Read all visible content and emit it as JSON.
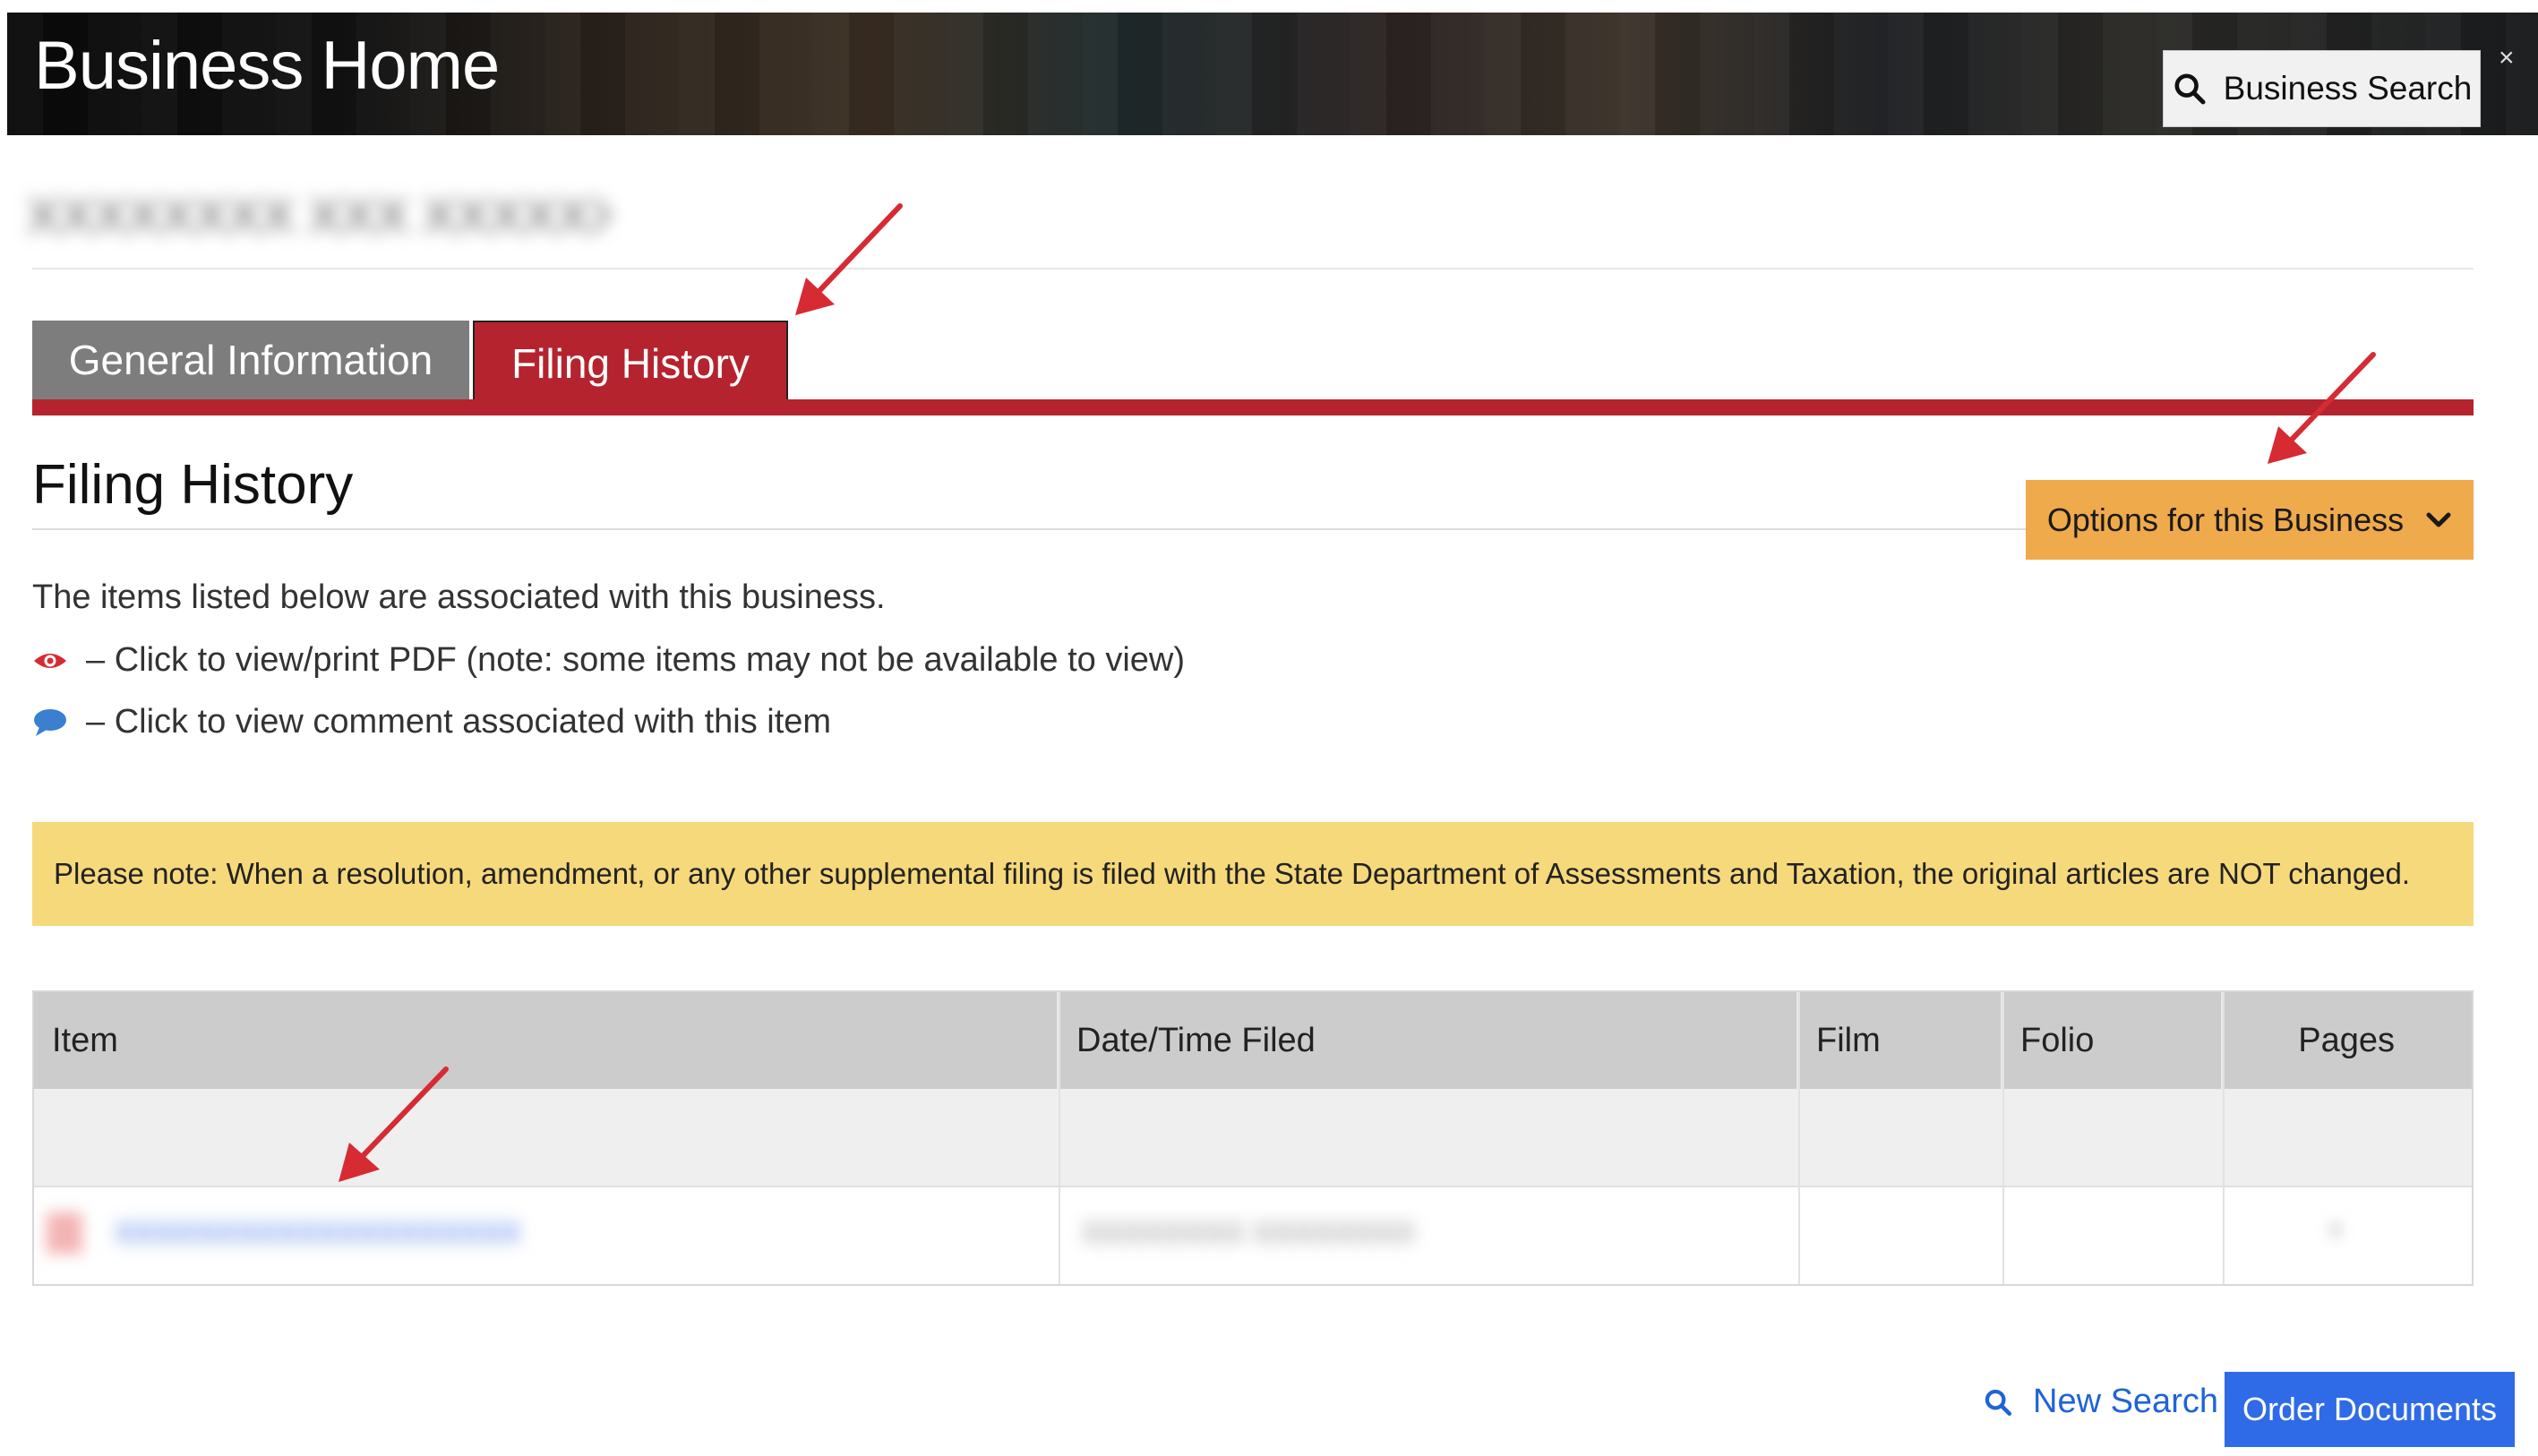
{
  "header": {
    "title": "Business Home",
    "search_button_label": "Business Search",
    "close_label": "×"
  },
  "business": {
    "name_blurred": "XXXXXXXX XXX XXXXXXXX"
  },
  "tabs": [
    {
      "label": "General Information",
      "active": false
    },
    {
      "label": "Filing History",
      "active": true
    }
  ],
  "section": {
    "title": "Filing History",
    "options_button_label": "Options for this Business",
    "intro": "The items listed below are associated with this business.",
    "legend": [
      {
        "icon": "eye-icon",
        "text": "– Click to view/print PDF (note: some items may not be available to view)"
      },
      {
        "icon": "comment-icon",
        "text": "– Click to view comment associated with this item"
      }
    ],
    "note": "Please note: When a resolution, amendment, or any other supplemental filing is filed with the State Department of Assessments and Taxation, the original articles are NOT changed."
  },
  "table": {
    "columns": [
      "Item",
      "Date/Time Filed",
      "Film",
      "Folio",
      "Pages"
    ],
    "rows": [
      {
        "item": "XXXXXXXXXXXXXXXXXXXX",
        "date": "XXXXXXXX XXXXXXXX",
        "pages": "X"
      }
    ]
  },
  "actions": {
    "new_search_label": "New Search",
    "order_documents_label": "Order Documents"
  },
  "colors": {
    "accent_red": "#b5232e",
    "tab_gray": "#7d7d7d",
    "options_orange": "#efaa4b",
    "note_yellow": "#f6d97b",
    "primary_blue": "#2f6be6",
    "link_blue": "#1f63d8",
    "annotation_arrow": "#d62b33"
  }
}
